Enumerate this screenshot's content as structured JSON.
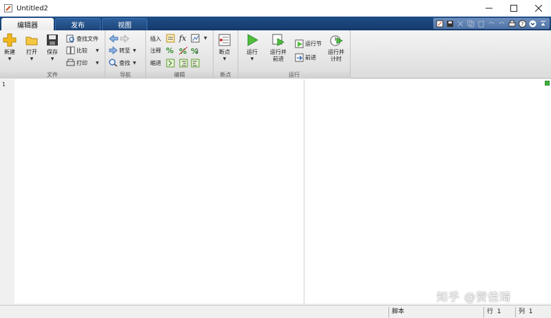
{
  "window": {
    "title": "Untitled2"
  },
  "tabs": [
    {
      "label": "编辑器",
      "active": true
    },
    {
      "label": "发布",
      "active": false
    },
    {
      "label": "视图",
      "active": false
    }
  ],
  "ribbon": {
    "file": {
      "label": "文件",
      "new": "新建",
      "open": "打开",
      "save": "保存",
      "find_files": "查找文件",
      "compare": "比较",
      "print": "打印"
    },
    "navigate": {
      "label": "导航",
      "goto": "转至",
      "find": "查找"
    },
    "edit": {
      "label": "编辑",
      "insert": "插入",
      "comment": "注释",
      "indent": "缩进",
      "fx": "fx",
      "percent": "%"
    },
    "breakpoints": {
      "label": "断点",
      "breakpoints": "断点"
    },
    "run": {
      "label": "运行",
      "run": "运行",
      "run_advance": "运行并\n前进",
      "run_section": "运行节",
      "advance": "前进",
      "run_time": "运行并\n计时"
    }
  },
  "editor": {
    "line_numbers": [
      "1"
    ],
    "content": ""
  },
  "watermark": "知乎 @贺佳琦",
  "status": {
    "mode": "脚本",
    "row_label": "行",
    "row_value": "1",
    "col_label": "列",
    "col_value": "1"
  },
  "colors": {
    "tabstrip": "#1f4d87",
    "ribbon": "#e8e8e8",
    "ok": "#3db33d"
  }
}
